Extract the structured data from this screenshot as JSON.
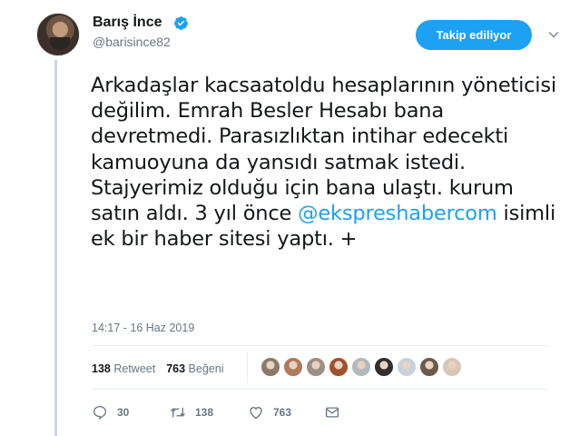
{
  "tweet": {
    "author": {
      "display_name": "Barış İnce",
      "username": "@barisince82",
      "verified": true
    },
    "follow_button_label": "Takip ediliyor",
    "text_before_mention": "Arkadaşlar kacsaatoldu hesaplarının yöneticisi değilim. Emrah Besler Hesabı bana devretmedi. Parasızlıktan intihar edecekti kamuoyuna da yansıdı satmak istedi. Stajyerimiz olduğu için bana ulaştı. kurum satın aldı. 3 yıl önce ",
    "mention": "@ekspreshabercom",
    "text_after_mention": " isimli ek bir haber sitesi yaptı. +",
    "timestamp": "14:17 - 16 Haz 2019",
    "stats": {
      "retweet_count": "138",
      "retweet_label": "Retweet",
      "like_count": "763",
      "like_label": "Beğeni"
    },
    "liker_avatar_colors": [
      "#8a7a6a",
      "#b07a5a",
      "#9a8f88",
      "#a0522d",
      "#b5b8bd",
      "#2f2f2f",
      "#c7d2dc",
      "#6b5a4c",
      "#d8c7b7"
    ],
    "actions": [
      {
        "icon": "reply-icon",
        "count": "30"
      },
      {
        "icon": "retweet-icon",
        "count": "138"
      },
      {
        "icon": "like-icon",
        "count": "763"
      },
      {
        "icon": "message-icon",
        "count": ""
      }
    ],
    "colors": {
      "accent": "#1da1f2",
      "muted": "#657786",
      "thread_line": "#ccd6dd"
    }
  }
}
